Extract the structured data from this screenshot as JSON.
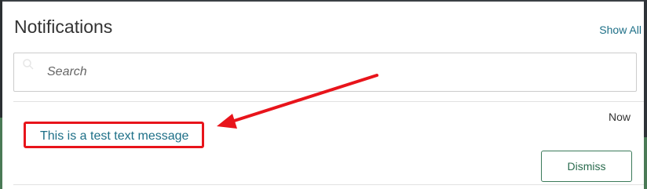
{
  "notifications": {
    "title": "Notifications",
    "show_all_label": "Show All",
    "search": {
      "placeholder": "Search",
      "value": "",
      "icon": "search-icon"
    },
    "items": [
      {
        "message": "This is a test text message",
        "timestamp": "Now",
        "dismiss_label": "Dismiss"
      }
    ]
  },
  "colors": {
    "link": "#1d6f87",
    "dismiss_border": "#3b7a5a",
    "annotation": "#e8141b"
  }
}
